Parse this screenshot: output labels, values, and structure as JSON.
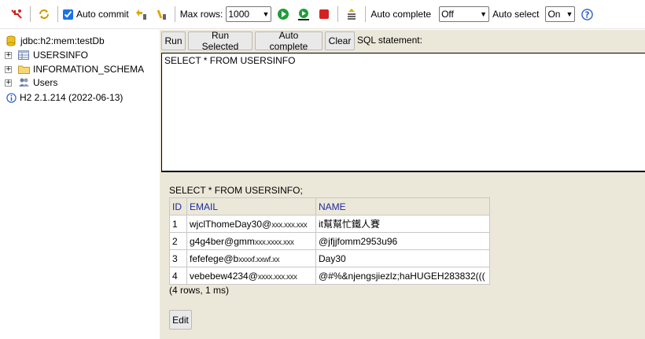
{
  "toolbar": {
    "auto_commit_label": "Auto commit",
    "auto_commit_checked": true,
    "max_rows_label": "Max rows:",
    "max_rows_value": "1000",
    "auto_complete_label": "Auto complete",
    "auto_complete_value": "Off",
    "auto_select_label": "Auto select",
    "auto_select_value": "On",
    "help_glyph": "?"
  },
  "sidebar": {
    "connection": "jdbc:h2:mem:testDb",
    "items": [
      {
        "label": "USERSINFO",
        "icon": "table-icon"
      },
      {
        "label": "INFORMATION_SCHEMA",
        "icon": "folder-icon"
      },
      {
        "label": "Users",
        "icon": "users-icon"
      }
    ],
    "version": "H2 2.1.214 (2022-06-13)"
  },
  "editor": {
    "buttons": {
      "run": "Run",
      "run_selected": "Run Selected",
      "auto_complete": "Auto complete",
      "clear": "Clear"
    },
    "sql_label": "SQL statement:",
    "sql_text": "SELECT * FROM USERSINFO"
  },
  "result": {
    "query": "SELECT * FROM USERSINFO;",
    "columns": [
      "ID",
      "EMAIL",
      "NAME"
    ],
    "rows": [
      {
        "id": "1",
        "email_local": "wjclThomeDay30@",
        "email_domain": "xxx.xxx.xxx",
        "name": "it幫幫忙鐵人賽"
      },
      {
        "id": "2",
        "email_local": "g4g4ber@gmm",
        "email_domain": "xxx.xxxx.xxx",
        "name": "@jfjjfomm2953u96"
      },
      {
        "id": "3",
        "email_local": "fefefege@b",
        "email_domain": "xxxxf.xxwf.xx",
        "name": "Day30"
      },
      {
        "id": "4",
        "email_local": "vebebew4234@",
        "email_domain": "xxxx.xxx.xxx",
        "name": "@#%&njengsjiezlz;haHUGEH283832((("
      }
    ],
    "summary": "(4 rows, 1 ms)",
    "edit_label": "Edit"
  },
  "colors": {
    "panel_bg": "#ece8d9",
    "header_text": "#1c2a9f",
    "run_green": "#1e9e3a",
    "stop_red": "#d42222"
  }
}
